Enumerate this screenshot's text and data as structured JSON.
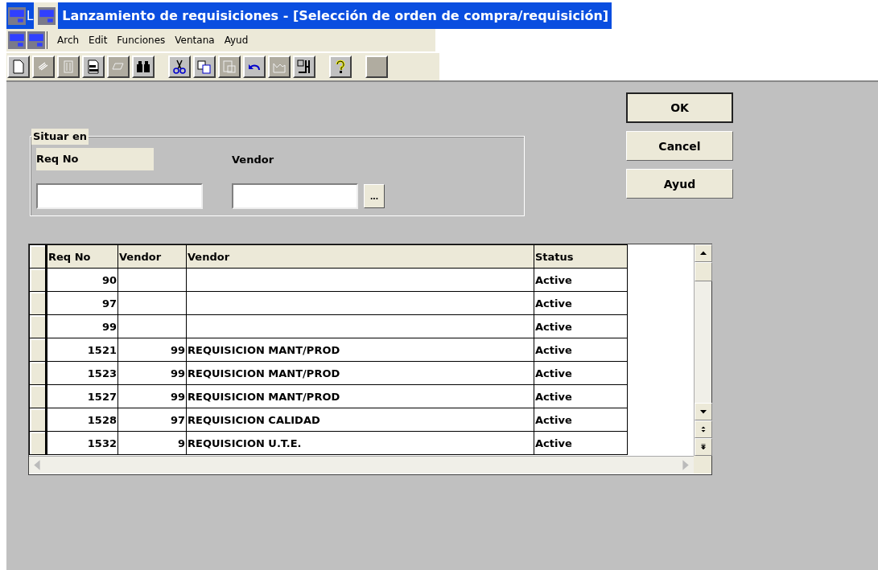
{
  "window": {
    "title": "Lanzamiento de requisiciones - [Selección de orden de compra/requisición]",
    "title_fragment": "L"
  },
  "menu": [
    "Arch",
    "Edit",
    "Funciones",
    "Ventana",
    "Ayud"
  ],
  "toolbar": [
    {
      "kind": "new",
      "disabled": false
    },
    {
      "kind": "grid",
      "disabled": true
    },
    {
      "kind": "trash",
      "disabled": true
    },
    {
      "kind": "print",
      "disabled": false
    },
    {
      "kind": "eraser",
      "disabled": true
    },
    {
      "kind": "binoculars",
      "disabled": false
    },
    {
      "kind": "gap"
    },
    {
      "kind": "cut",
      "disabled": false
    },
    {
      "kind": "copy",
      "disabled": false
    },
    {
      "kind": "paste",
      "disabled": true
    },
    {
      "kind": "undo",
      "disabled": false
    },
    {
      "kind": "chart",
      "disabled": true
    },
    {
      "kind": "exit",
      "disabled": false
    },
    {
      "kind": "gap"
    },
    {
      "kind": "help",
      "disabled": false
    },
    {
      "kind": "gap"
    },
    {
      "kind": "blank",
      "disabled": true
    }
  ],
  "group": {
    "title": "Situar en",
    "req_label": "Req No",
    "vendor_label": "Vendor",
    "browse": "..."
  },
  "buttons": [
    {
      "label": "OK",
      "default": true
    },
    {
      "label": "Cancel",
      "default": false
    },
    {
      "label": "Ayud",
      "default": false
    }
  ],
  "table": {
    "columns": [
      "Req No",
      "Vendor",
      "Vendor",
      "Status"
    ],
    "rows": [
      [
        "90",
        "",
        "",
        "Active"
      ],
      [
        "97",
        "",
        "",
        "Active"
      ],
      [
        "99",
        "",
        "",
        "Active"
      ],
      [
        "1521",
        "99",
        "REQUISICION MANT/PROD",
        "Active"
      ],
      [
        "1523",
        "99",
        "REQUISICION MANT/PROD",
        "Active"
      ],
      [
        "1527",
        "99",
        "REQUISICION MANT/PROD",
        "Active"
      ],
      [
        "1528",
        "97",
        "REQUISICION CALIDAD",
        "Active"
      ],
      [
        "1532",
        "9",
        "REQUISICION U.T.E.",
        "Active"
      ]
    ]
  }
}
